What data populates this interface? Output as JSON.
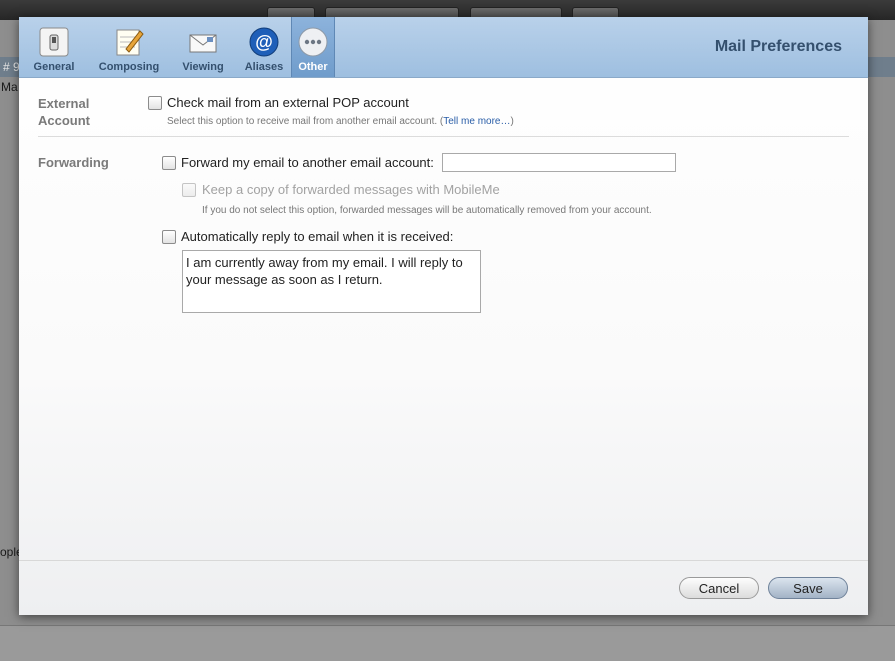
{
  "background": {
    "strip_left_text": "# 9",
    "side_text_top": "Ma",
    "side_text_bottom": "ople"
  },
  "dialog": {
    "title": "Mail Preferences",
    "tabs": [
      {
        "label": "General",
        "icon": "switch-icon",
        "active": false
      },
      {
        "label": "Composing",
        "icon": "notepad-pencil-icon",
        "active": false
      },
      {
        "label": "Viewing",
        "icon": "envelope-icon",
        "active": false
      },
      {
        "label": "Aliases",
        "icon": "at-sign-icon",
        "active": true
      },
      {
        "label": "Other",
        "icon": "ellipsis-icon",
        "active": true
      }
    ],
    "external": {
      "label_line1": "External",
      "label_line2": "Account",
      "checkbox_label": "Check mail from an external POP account",
      "hint_text": "Select this option to receive mail from another email account. (",
      "hint_link": "Tell me more…",
      "hint_close": ")"
    },
    "forwarding": {
      "label": "Forwarding",
      "forward_label": "Forward my email to another email account:",
      "forward_value": "",
      "keep_copy_label": "Keep a copy of forwarded messages with MobileMe",
      "keep_copy_hint": "If you do not select this option, forwarded messages will be automatically removed from your account.",
      "auto_reply_label": "Automatically reply to email when it is received:",
      "auto_reply_message": "I am currently away from my email. I will reply to your message as soon as I return."
    },
    "buttons": {
      "cancel": "Cancel",
      "save": "Save"
    },
    "colors": {
      "header": "#a9c7e6",
      "active_tab": "#7ea7d3",
      "title": "#34506e"
    }
  }
}
